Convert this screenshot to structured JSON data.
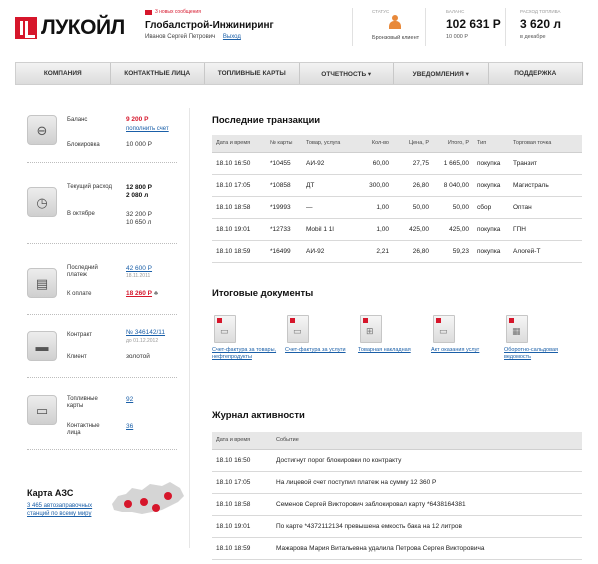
{
  "header": {
    "logo_text": "ЛУКОЙЛ",
    "messages": "3 новых сообщения",
    "company": "Глобалстрой-Инжиниринг",
    "user": "Иванов Сергей Петрович",
    "logout": "Выход",
    "status_label": "СТАТУС",
    "status_value": "Бронзовый клиент",
    "balance_label": "БАЛАНС",
    "balance_value": "102 631 Р",
    "balance_sub": "10 000 Р",
    "expense_label": "РАСХОД ТОПЛИВА",
    "expense_value": "3 620 л",
    "expense_sub": "в декабре"
  },
  "nav": [
    "КОМПАНИЯ",
    "КОНТАКТНЫЕ ЛИЦА",
    "ТОПЛИВНЫЕ КАРТЫ",
    "ОТЧЕТНОСТЬ ▾",
    "УВЕДОМЛЕНИЯ ▾",
    "ПОДДЕРЖКА"
  ],
  "left": {
    "balance_label": "Баланс",
    "balance_value": "9 200 Р",
    "topup": "пополнить счет",
    "block_label": "Блокировка",
    "block_value": "10 000 Р",
    "cur_label": "Текущий расход",
    "cur_v1": "12 800 Р",
    "cur_v2": "2 080 л",
    "oct_label": "В октябре",
    "oct_v1": "32 200 Р",
    "oct_v2": "10 650 л",
    "last_label": "Последний платеж",
    "last_value": "42 600 Р",
    "last_date": "18.11.2011",
    "topay_label": "К оплате",
    "topay_value": "18 260 Р",
    "contract_label": "Контракт",
    "contract_value": "№ 346142/11",
    "contract_date": "до 01.12.2012",
    "client_label": "Клиент",
    "client_value": "золотой",
    "cards_label": "Топливные карты",
    "cards_value": "92",
    "contacts_label": "Контактные лица",
    "contacts_value": "36",
    "map_title": "Карта АЗС",
    "map_link": "3 465 автозаправочных станций по всему миру"
  },
  "transactions": {
    "title": "Последние транзакции",
    "headers": [
      "Дата и время",
      "№ карты",
      "Товар, услуга",
      "Кол-во",
      "Цена, Р",
      "Итого, Р",
      "Тип",
      "Торговая точка"
    ],
    "rows": [
      [
        "18.10 16:50",
        "*10455",
        "АИ-92",
        "60,00",
        "27,75",
        "1 665,00",
        "покупка",
        "Транзит"
      ],
      [
        "18.10 17:05",
        "*10858",
        "ДТ",
        "300,00",
        "26,80",
        "8 040,00",
        "покупка",
        "Магистраль"
      ],
      [
        "18.10 18:58",
        "*19993",
        "—",
        "1,00",
        "50,00",
        "50,00",
        "сбор",
        "Оптан"
      ],
      [
        "18.10 19:01",
        "*12733",
        "Mobil 1 1l",
        "1,00",
        "425,00",
        "425,00",
        "покупка",
        "ГПН"
      ],
      [
        "18.10 18:59",
        "*16499",
        "АИ-92",
        "2,21",
        "26,80",
        "59,23",
        "покупка",
        "Алогей-Т"
      ]
    ]
  },
  "documents": {
    "title": "Итоговые документы",
    "items": [
      "Счет-фактура за товары, нефтепродукты",
      "Счет-фактура за услуги",
      "Товарная накладная",
      "Акт оказания услуг",
      "Оборотно-сальдовая ведомость"
    ]
  },
  "activity": {
    "title": "Журнал активности",
    "headers": [
      "Дата и время",
      "Событие"
    ],
    "rows": [
      [
        "18.10 16:50",
        "Достигнут порог блокировки по контракту"
      ],
      [
        "18.10 17:05",
        "На лицевой счет поступил платеж на сумму 12 360 Р"
      ],
      [
        "18.10 18:58",
        "Семенов Сергей Викторович заблокировал карту *6438164381"
      ],
      [
        "18.10 19:01",
        "По карте *4372112134 превышена емкость бака на 12 литров"
      ],
      [
        "18.10 18:59",
        "Мажарова Мария Витальевна удалила Петрова Сергея Викторовича"
      ]
    ]
  }
}
